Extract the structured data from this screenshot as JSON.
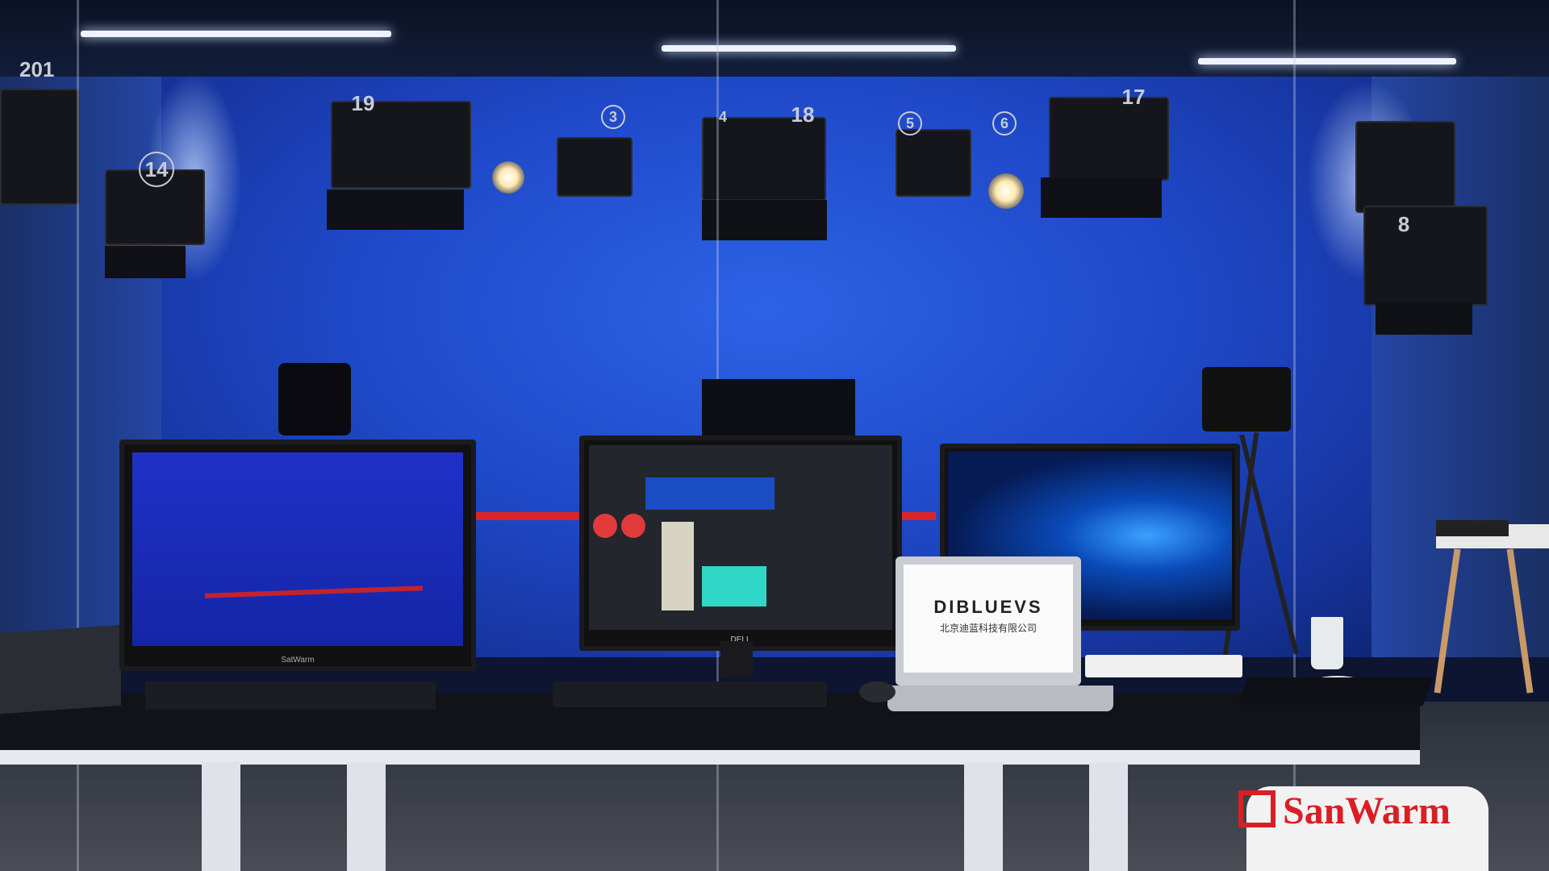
{
  "scene": {
    "light_numbers": [
      "201",
      "19",
      "14",
      "3",
      "4",
      "18",
      "5",
      "6",
      "17",
      "8"
    ],
    "monitor_left_brand": "SatWarm",
    "monitor_center_brand": "DELL",
    "laptop_logo": "DIBLUEVS",
    "laptop_subtitle": "北京迪蓝科技有限公司",
    "watermark": "SanWarm"
  },
  "colors": {
    "backdrop": "#1f49c9",
    "stripe": "#d8262c",
    "watermark": "#d91f24"
  }
}
